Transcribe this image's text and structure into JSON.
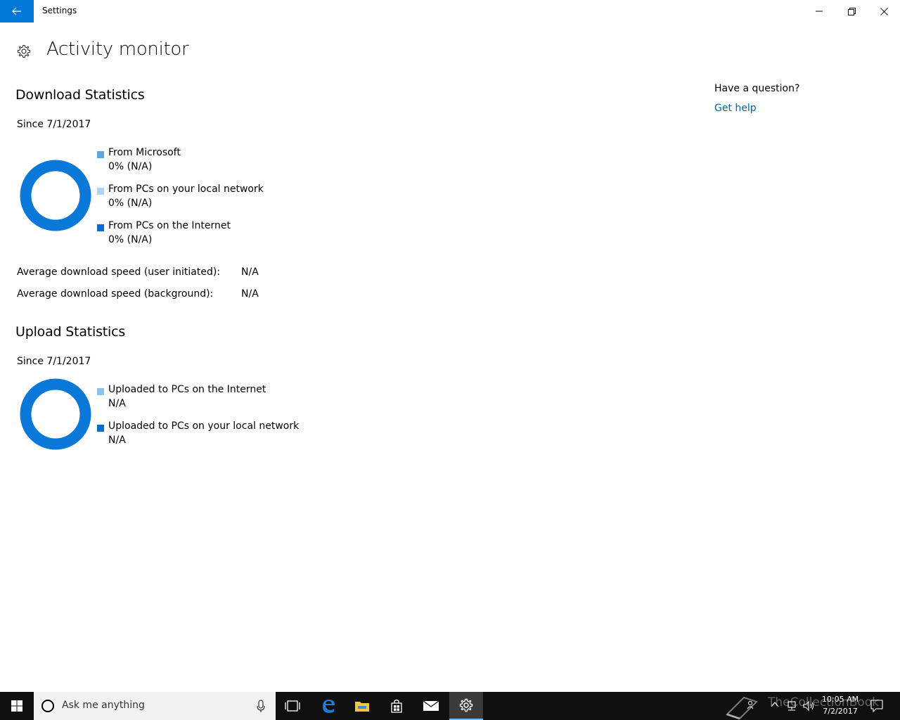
{
  "window": {
    "title": "Settings"
  },
  "page": {
    "title": "Activity monitor"
  },
  "download": {
    "title": "Download Statistics",
    "since": "Since 7/1/2017",
    "legend": [
      {
        "label": "From Microsoft",
        "value": "0% (N/A)",
        "color": "#5ea8e0"
      },
      {
        "label": "From PCs on your local network",
        "value": "0% (N/A)",
        "color": "#b0d4f1"
      },
      {
        "label": "From PCs on the Internet",
        "value": "0% (N/A)",
        "color": "#0a6ccc"
      }
    ],
    "stats": [
      {
        "label": "Average download speed (user initiated):",
        "value": "N/A"
      },
      {
        "label": "Average download speed (background):",
        "value": "N/A"
      }
    ]
  },
  "upload": {
    "title": "Upload Statistics",
    "since": "Since 7/1/2017",
    "legend": [
      {
        "label": "Uploaded to PCs on the Internet",
        "value": "N/A",
        "color": "#8ec2ea"
      },
      {
        "label": "Uploaded to PCs on your local network",
        "value": "N/A",
        "color": "#0a6ccc"
      }
    ]
  },
  "help": {
    "question": "Have a question?",
    "link": "Get help"
  },
  "colors": {
    "accent": "#0078d7",
    "donut": "#0a78d8",
    "link": "#0063b1"
  },
  "taskbar": {
    "search_placeholder": "Ask me anything",
    "time": "10:05 AM",
    "date": "7/2/2017",
    "watermark": "TheCollectionBook"
  }
}
